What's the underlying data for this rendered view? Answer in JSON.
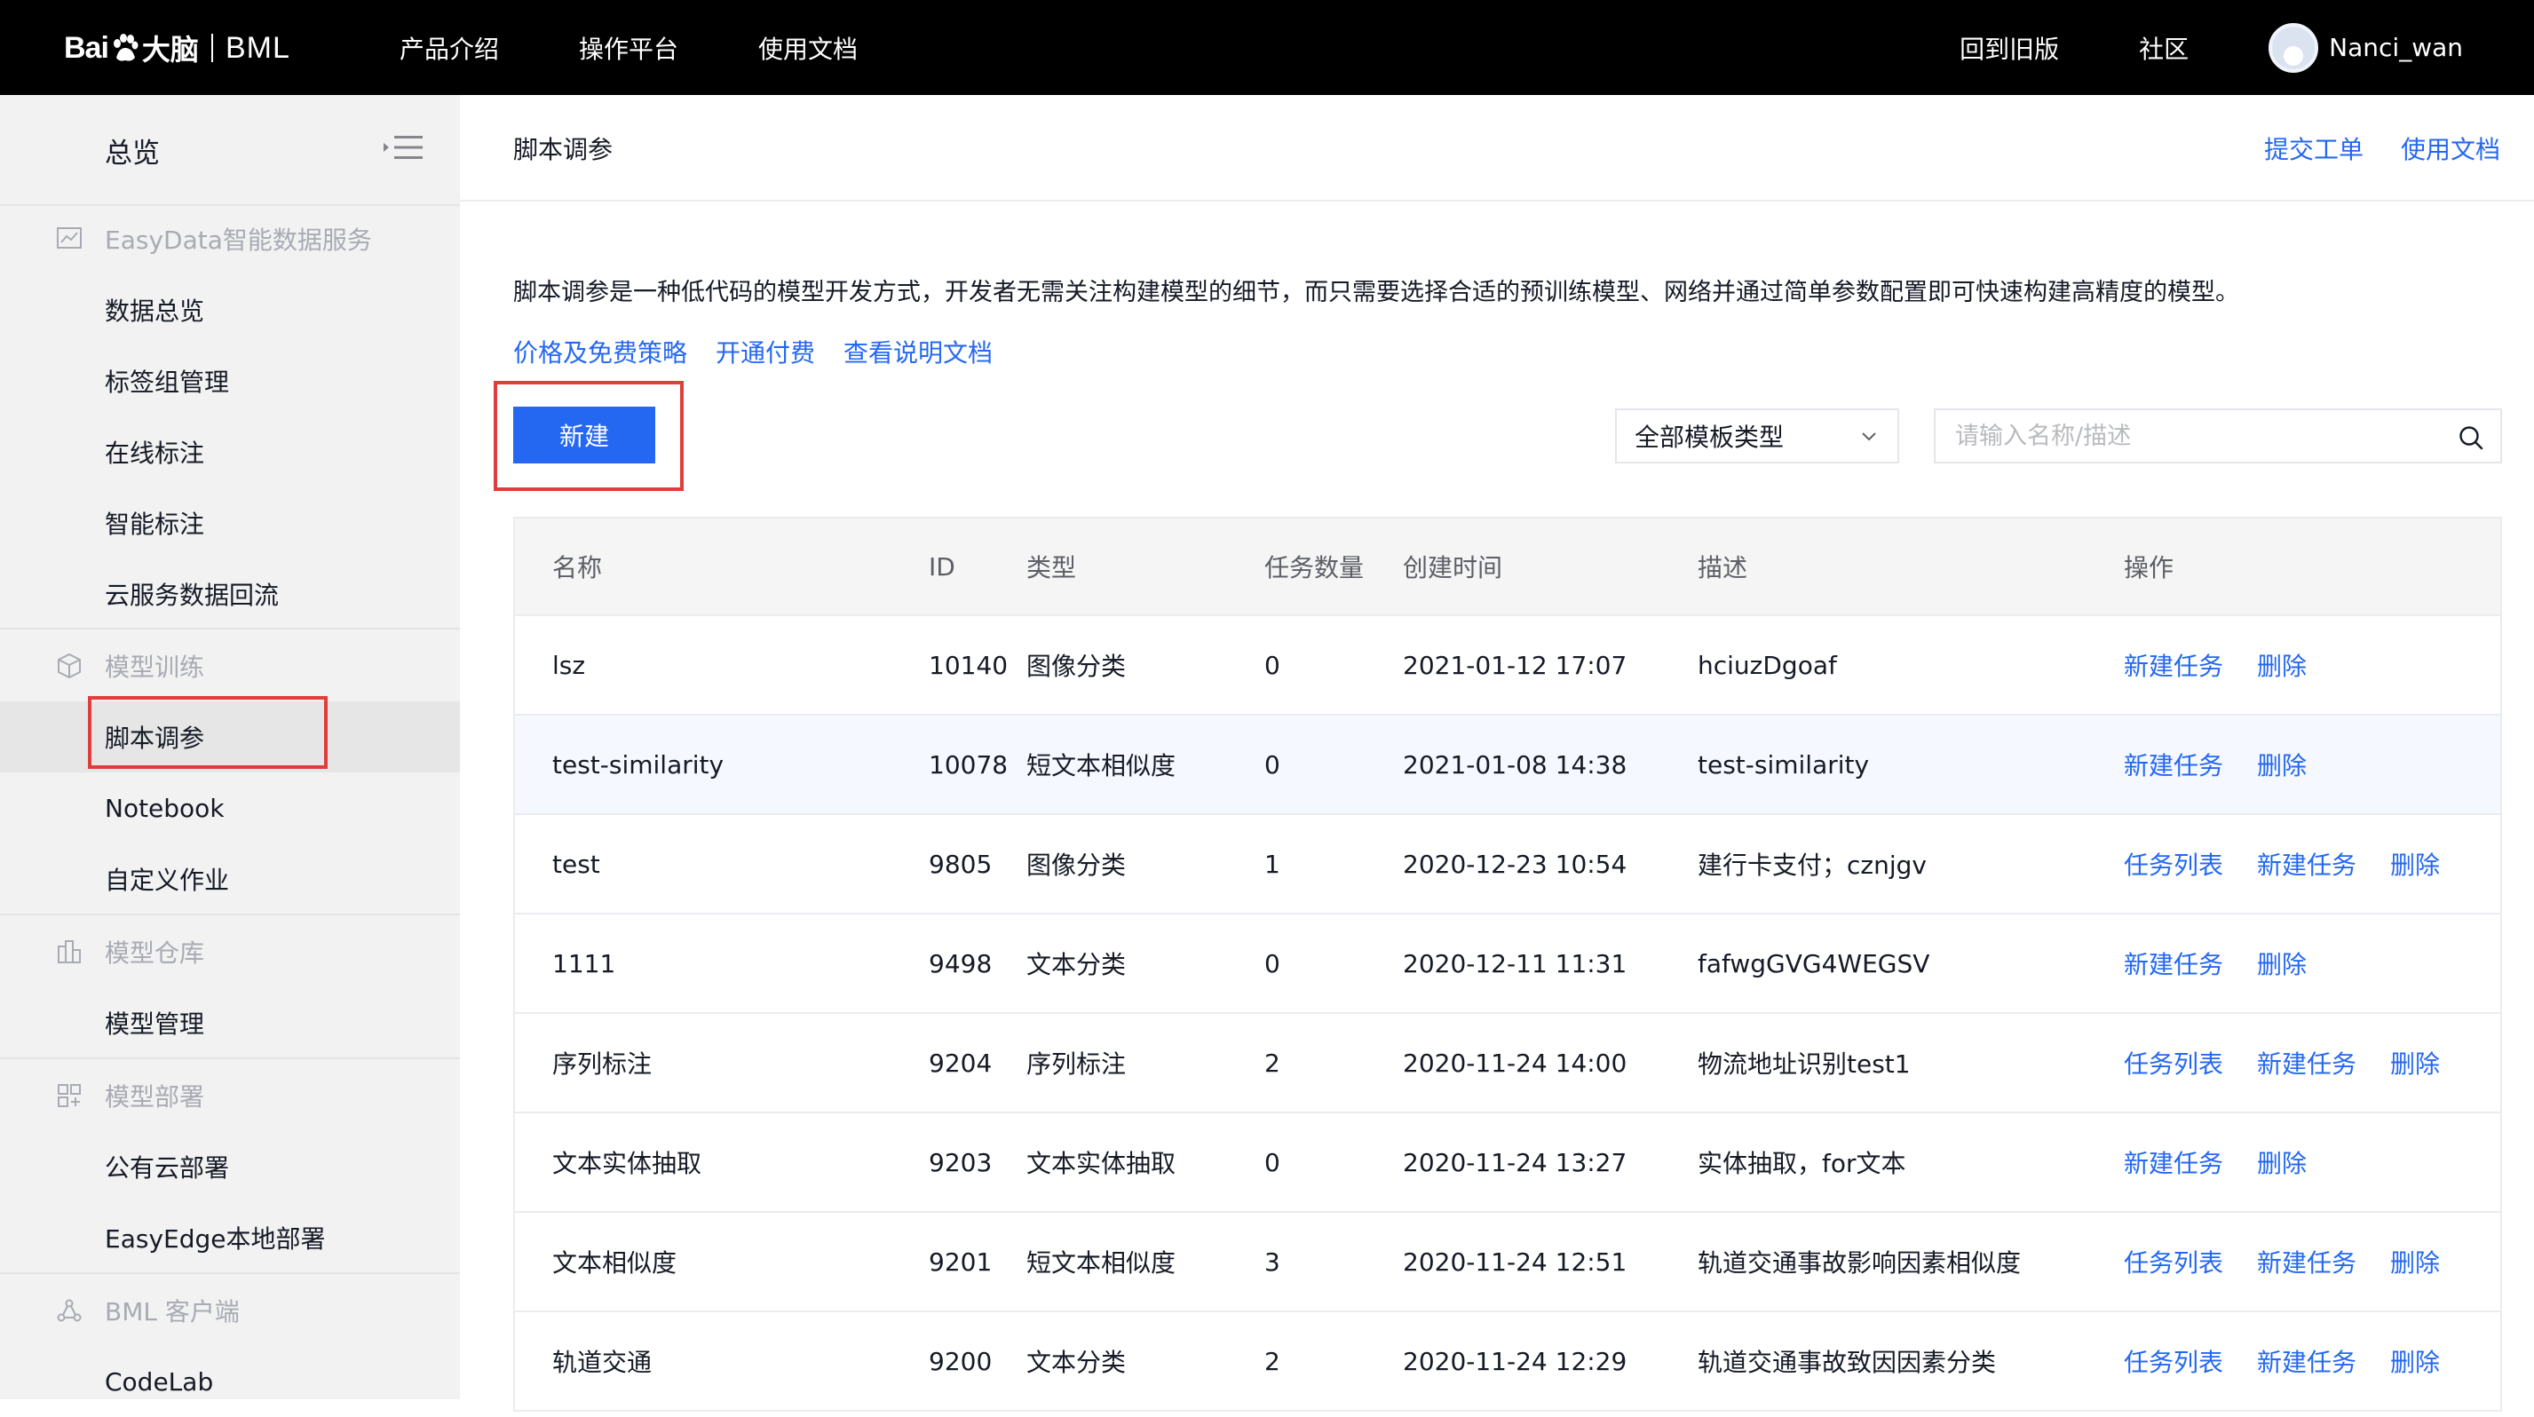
{
  "topbar": {
    "logo_bai": "Bai",
    "logo_danao": "大脑",
    "logo_bml": "BML",
    "nav_left": [
      "产品介绍",
      "操作平台",
      "使用文档"
    ],
    "nav_right": [
      "回到旧版",
      "社区"
    ],
    "username": "Nanci_wan"
  },
  "sidebar": {
    "overview": "总览",
    "groups": {
      "easydata": {
        "label": "EasyData智能数据服务",
        "items": [
          "数据总览",
          "标签组管理",
          "在线标注",
          "智能标注",
          "云服务数据回流"
        ]
      },
      "train": {
        "label": "模型训练",
        "items": [
          "脚本调参",
          "Notebook",
          "自定义作业"
        ]
      },
      "repo": {
        "label": "模型仓库",
        "items": [
          "模型管理"
        ]
      },
      "deploy": {
        "label": "模型部署",
        "items": [
          "公有云部署",
          "EasyEdge本地部署"
        ]
      },
      "client": {
        "label": "BML 客户端",
        "items": [
          "CodeLab"
        ]
      }
    }
  },
  "header": {
    "title": "脚本调参",
    "links": [
      "提交工单",
      "使用文档"
    ]
  },
  "intro": {
    "description": "脚本调参是一种低代码的模型开发方式，开发者无需关注构建模型的细节，而只需要选择合适的预训练模型、网络并通过简单参数配置即可快速构建高精度的模型。",
    "links": [
      "价格及免费策略",
      "开通付费",
      "查看说明文档"
    ]
  },
  "toolbar": {
    "new_label": "新建",
    "template_select": "全部模板类型",
    "search_placeholder": "请输入名称/描述"
  },
  "table": {
    "columns": [
      "名称",
      "ID",
      "类型",
      "任务数量",
      "创建时间",
      "描述",
      "操作"
    ],
    "rows": [
      {
        "name": "lsz",
        "id": "10140",
        "type": "图像分类",
        "count": "0",
        "time": "2021-01-12 17:07",
        "desc": "hciuzDgoaf",
        "ops": [
          "新建任务",
          "删除"
        ]
      },
      {
        "name": "test-similarity",
        "id": "10078",
        "type": "短文本相似度",
        "count": "0",
        "time": "2021-01-08 14:38",
        "desc": "test-similarity",
        "ops": [
          "新建任务",
          "删除"
        ]
      },
      {
        "name": "test",
        "id": "9805",
        "type": "图像分类",
        "count": "1",
        "time": "2020-12-23 10:54",
        "desc": "建行卡支付；cznjgv",
        "ops": [
          "任务列表",
          "新建任务",
          "删除"
        ]
      },
      {
        "name": "1111",
        "id": "9498",
        "type": "文本分类",
        "count": "0",
        "time": "2020-12-11 11:31",
        "desc": "fafwgGVG4WEGSV",
        "ops": [
          "新建任务",
          "删除"
        ]
      },
      {
        "name": "序列标注",
        "id": "9204",
        "type": "序列标注",
        "count": "2",
        "time": "2020-11-24 14:00",
        "desc": "物流地址识别test1",
        "ops": [
          "任务列表",
          "新建任务",
          "删除"
        ]
      },
      {
        "name": "文本实体抽取",
        "id": "9203",
        "type": "文本实体抽取",
        "count": "0",
        "time": "2020-11-24 13:27",
        "desc": "实体抽取，for文本",
        "ops": [
          "新建任务",
          "删除"
        ]
      },
      {
        "name": "文本相似度",
        "id": "9201",
        "type": "短文本相似度",
        "count": "3",
        "time": "2020-11-24 12:51",
        "desc": "轨道交通事故影响因素相似度",
        "ops": [
          "任务列表",
          "新建任务",
          "删除"
        ]
      },
      {
        "name": "轨道交通",
        "id": "9200",
        "type": "文本分类",
        "count": "2",
        "time": "2020-11-24 12:29",
        "desc": "轨道交通事故致因因素分类",
        "ops": [
          "任务列表",
          "新建任务",
          "删除"
        ]
      }
    ]
  },
  "colors": {
    "accent": "#2468f2",
    "highlight_box": "#e03e3b",
    "topbar": "#000000"
  }
}
